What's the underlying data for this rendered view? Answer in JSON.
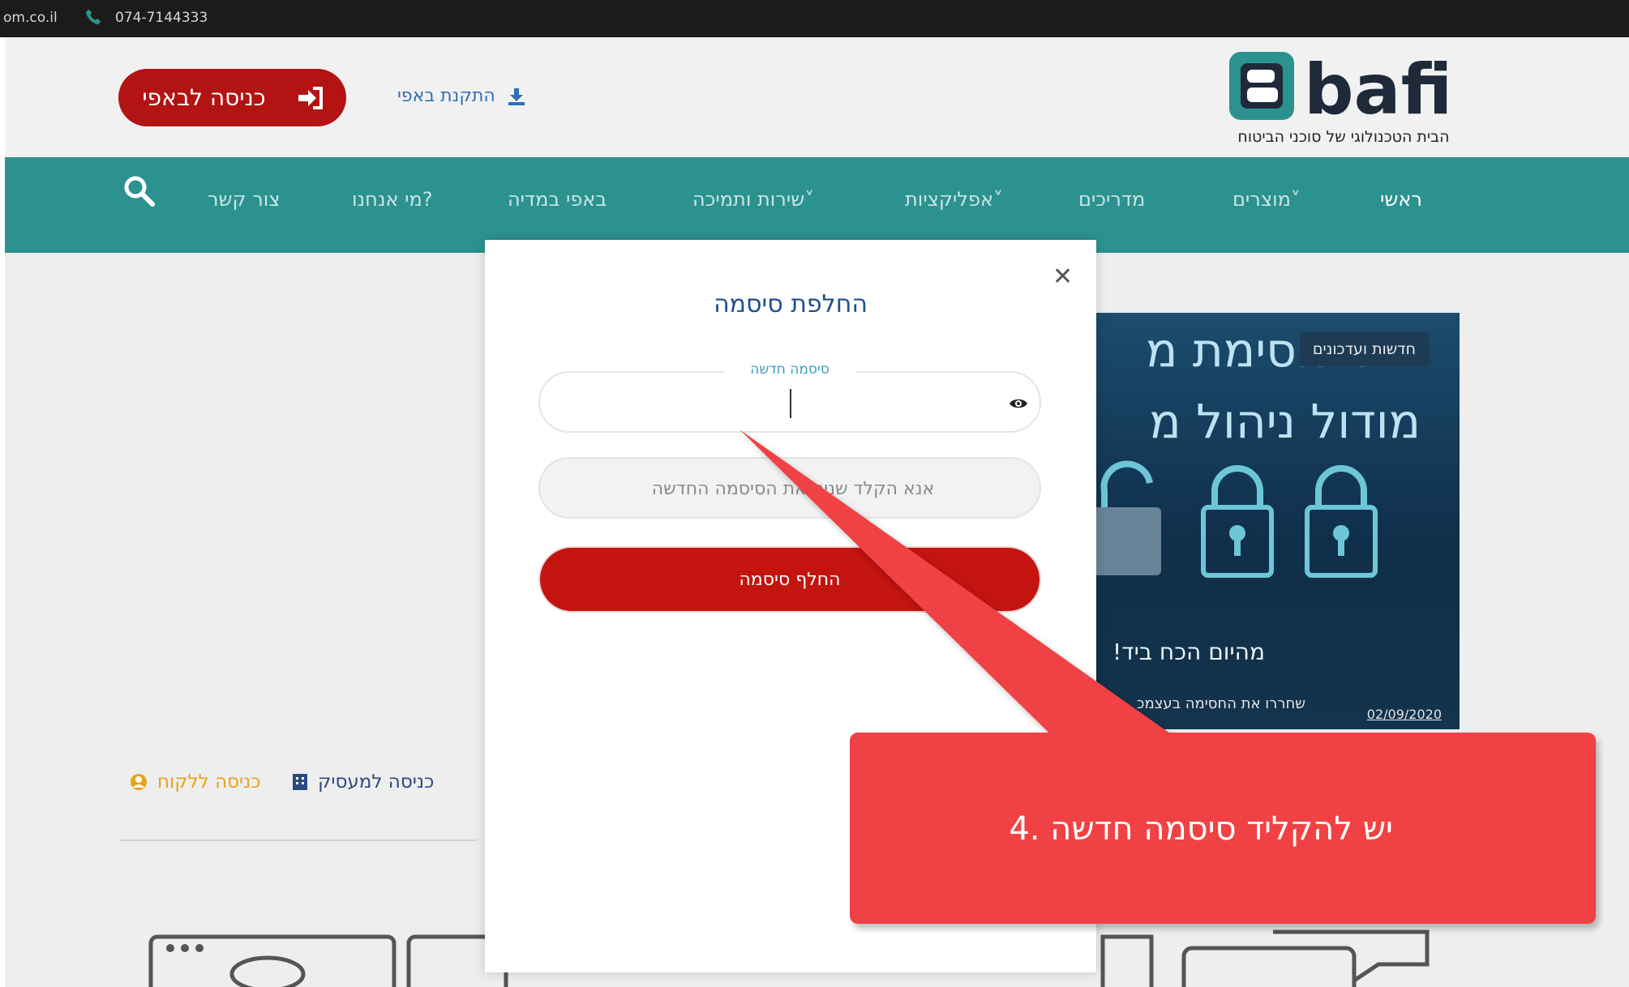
{
  "topbar": {
    "domain": "om.co.il",
    "phone": "074-7144333"
  },
  "header": {
    "login_button": "כניסה לבאפי",
    "install_link": "התקנת באפי",
    "logo_text": "bafi",
    "logo_tagline": "הבית הטכנולוגי של סוכני הביטוח"
  },
  "nav": {
    "items": [
      "ראשי",
      "מוצרים˅",
      "מדריכים",
      "אפליקציות˅",
      "שירות ותמיכה˅",
      "באפי במדיה",
      "מי אנחנו?",
      "צור קשר"
    ]
  },
  "banner": {
    "chip": "חדשות ועדכונים",
    "headline_1": "ר חסימת מ",
    "headline_2": "מודול ניהול מ",
    "cta": "!מהיום הכח ביד",
    "sub": "שחררו את החסימה בעצמכ",
    "date": "02/09/2020"
  },
  "footer": {
    "client_login": "כניסה ללקוח",
    "employer_login": "כניסה למעסיק"
  },
  "modal": {
    "title": "החלפת סיסמה",
    "new_password_label": "סיסמה חדשה",
    "new_password_value": "",
    "confirm_placeholder": "אנא הקלד שנית את הסיסמה החדשה",
    "submit": "החלף סיסמה"
  },
  "annotation": {
    "text": "4. יש להקליד סיסמה חדשה"
  },
  "colors": {
    "nav_bg": "#2c9290",
    "primary_red": "#c41410",
    "callout_red": "#f04244",
    "title_blue": "#1e4f8a"
  }
}
